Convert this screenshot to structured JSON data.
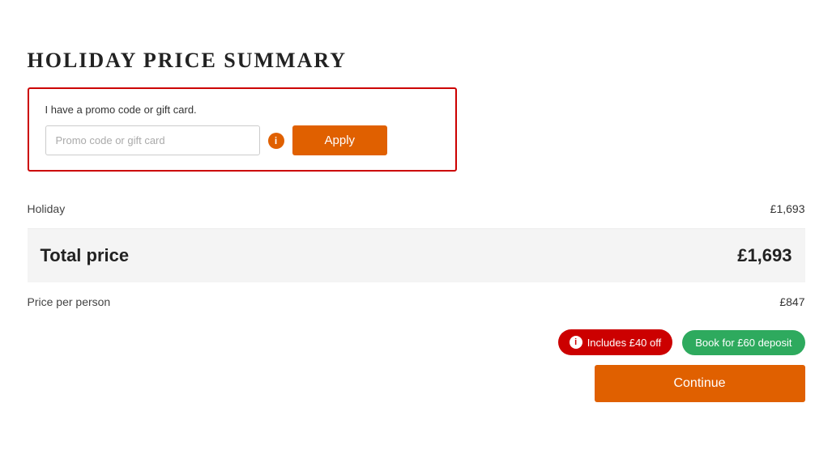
{
  "page": {
    "title": "HOLIDAY PRICE SUMMARY"
  },
  "promo": {
    "label": "I have a promo code or gift card.",
    "input_placeholder": "Promo code or gift card",
    "apply_label": "Apply",
    "info_icon": "i"
  },
  "pricing": {
    "holiday_label": "Holiday",
    "holiday_value": "£1,693",
    "total_label": "Total price",
    "total_value": "£1,693",
    "per_person_label": "Price per person",
    "per_person_value": "£847"
  },
  "actions": {
    "discount_badge": "Includes £40 off",
    "deposit_badge": "Book for £60 deposit",
    "continue_label": "Continue"
  },
  "colors": {
    "orange": "#e06000",
    "red": "#cc0000",
    "green": "#2eaa5e"
  }
}
